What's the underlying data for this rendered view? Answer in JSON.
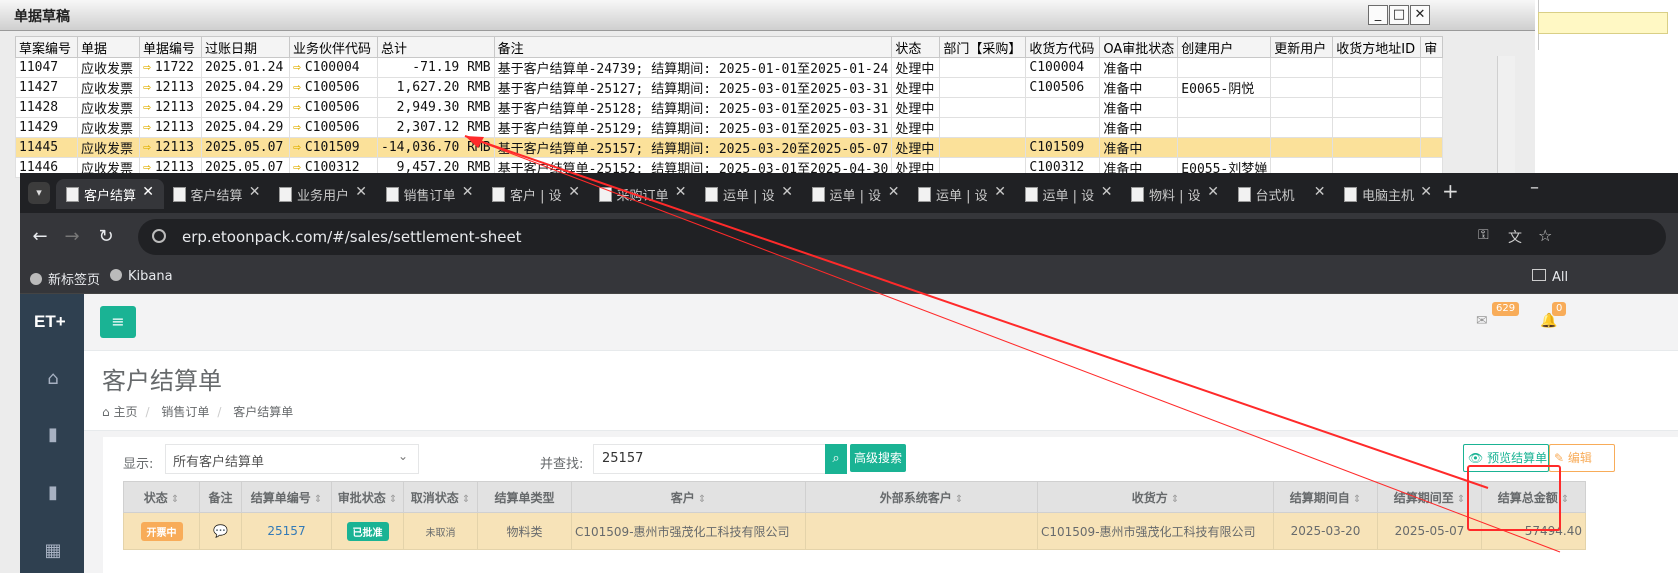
{
  "sap_window": {
    "title": "单据草稿",
    "buttons": [
      "_",
      "□",
      "✕"
    ],
    "columns": [
      "草案编号",
      "单据",
      "单据编号",
      "过账日期",
      "业务伙伴代码",
      "总计",
      "备注",
      "状态",
      "部门【采购】",
      "收货方代码",
      "OA审批状态",
      "创建用户",
      "更新用户",
      "收货方地址ID",
      "审"
    ],
    "rows": [
      {
        "id": "11047",
        "doc": "应收发票",
        "num": "11722",
        "date": "2025.01.24",
        "bp": "C100004",
        "total": "-71.19 RMB",
        "remark": "基于客户结算单-24739; 结算期间: 2025-01-01至2025-01-24",
        "status": "处理中",
        "dept": "",
        "recv": "C100004",
        "oa": "准备中",
        "creator": "",
        "updater": "",
        "addr": "",
        "audit": ""
      },
      {
        "id": "11427",
        "doc": "应收发票",
        "num": "12113",
        "date": "2025.04.29",
        "bp": "C100506",
        "total": "1,627.20 RMB",
        "remark": "基于客户结算单-25127; 结算期间: 2025-03-01至2025-03-31",
        "status": "处理中",
        "dept": "",
        "recv": "C100506",
        "oa": "准备中",
        "creator": "E0065-阴悦",
        "updater": "",
        "addr": "",
        "audit": ""
      },
      {
        "id": "11428",
        "doc": "应收发票",
        "num": "12113",
        "date": "2025.04.29",
        "bp": "C100506",
        "total": "2,949.30 RMB",
        "remark": "基于客户结算单-25128; 结算期间: 2025-03-01至2025-03-31",
        "status": "处理中",
        "dept": "",
        "recv": "",
        "oa": "准备中",
        "creator": "",
        "updater": "",
        "addr": "",
        "audit": ""
      },
      {
        "id": "11429",
        "doc": "应收发票",
        "num": "12113",
        "date": "2025.04.29",
        "bp": "C100506",
        "total": "2,307.12 RMB",
        "remark": "基于客户结算单-25129; 结算期间: 2025-03-01至2025-03-31",
        "status": "处理中",
        "dept": "",
        "recv": "",
        "oa": "准备中",
        "creator": "",
        "updater": "",
        "addr": "",
        "audit": ""
      },
      {
        "id": "11445",
        "doc": "应收发票",
        "num": "12113",
        "date": "2025.05.07",
        "bp": "C101509",
        "total": "-14,036.70 RMB",
        "remark": "基于客户结算单-25157; 结算期间: 2025-03-20至2025-05-07",
        "status": "处理中",
        "dept": "",
        "recv": "C101509",
        "oa": "准备中",
        "creator": "",
        "updater": "",
        "addr": "",
        "audit": ""
      },
      {
        "id": "11446",
        "doc": "应收发票",
        "num": "12113",
        "date": "2025.05.07",
        "bp": "C100312",
        "total": "9,457.20 RMB",
        "remark": "基于客户结算单-25152; 结算期间: 2025-03-01至2025-04-30",
        "status": "处理中",
        "dept": "",
        "recv": "C100312",
        "oa": "准备中",
        "creator": "E0055-刘梦婵",
        "updater": "",
        "addr": "",
        "audit": ""
      }
    ]
  },
  "browser": {
    "tabs": [
      "客户结算",
      "客户结算",
      "业务用户",
      "销售订单",
      "客户 | 设",
      "采购订单",
      "运单 | 设",
      "运单 | 设",
      "运单 | 设",
      "运单 | 设",
      "物料 | 设",
      "台式机 ",
      "电脑主机"
    ],
    "url": "erp.etoonpack.com/#/sales/settlement-sheet",
    "bookmarks": [
      "新标签页",
      "Kibana"
    ],
    "bookmarks_all": "All"
  },
  "app": {
    "brand": "ET+",
    "notifications": {
      "messages": "629",
      "alerts": "0"
    },
    "page_title": "客户结算单",
    "breadcrumbs": [
      "主页",
      "销售订单",
      "客户结算单"
    ],
    "filter": {
      "show_label": "显示:",
      "show_value": "所有客户结算单",
      "search_label": "并查找:",
      "search_value": "25157",
      "advanced_label": "高级搜索"
    },
    "actions": {
      "preview": "预览结算单",
      "edit": "编辑"
    },
    "table": {
      "columns": [
        "状态",
        "备注",
        "结算单编号",
        "审批状态",
        "取消状态",
        "结算单类型",
        "客户",
        "外部系统客户",
        "收货方",
        "结算期间自",
        "结算期间至",
        "结算总金额"
      ],
      "row": {
        "status": "开票中",
        "remark": "💬",
        "number": "25157",
        "approval": "已批准",
        "cancel": "未取消",
        "type": "物料类",
        "customer": "C101509-惠州市强茂化工科技有限公司",
        "external": "",
        "receiver": "C101509-惠州市强茂化工科技有限公司",
        "from": "2025-03-20",
        "to": "2025-05-07",
        "total": "57494.40"
      }
    }
  },
  "colors": {
    "accent": "#1ab394",
    "warning": "#f8ac59",
    "highlight_row": "#f7e3b8",
    "annotation": "#ff0000"
  }
}
